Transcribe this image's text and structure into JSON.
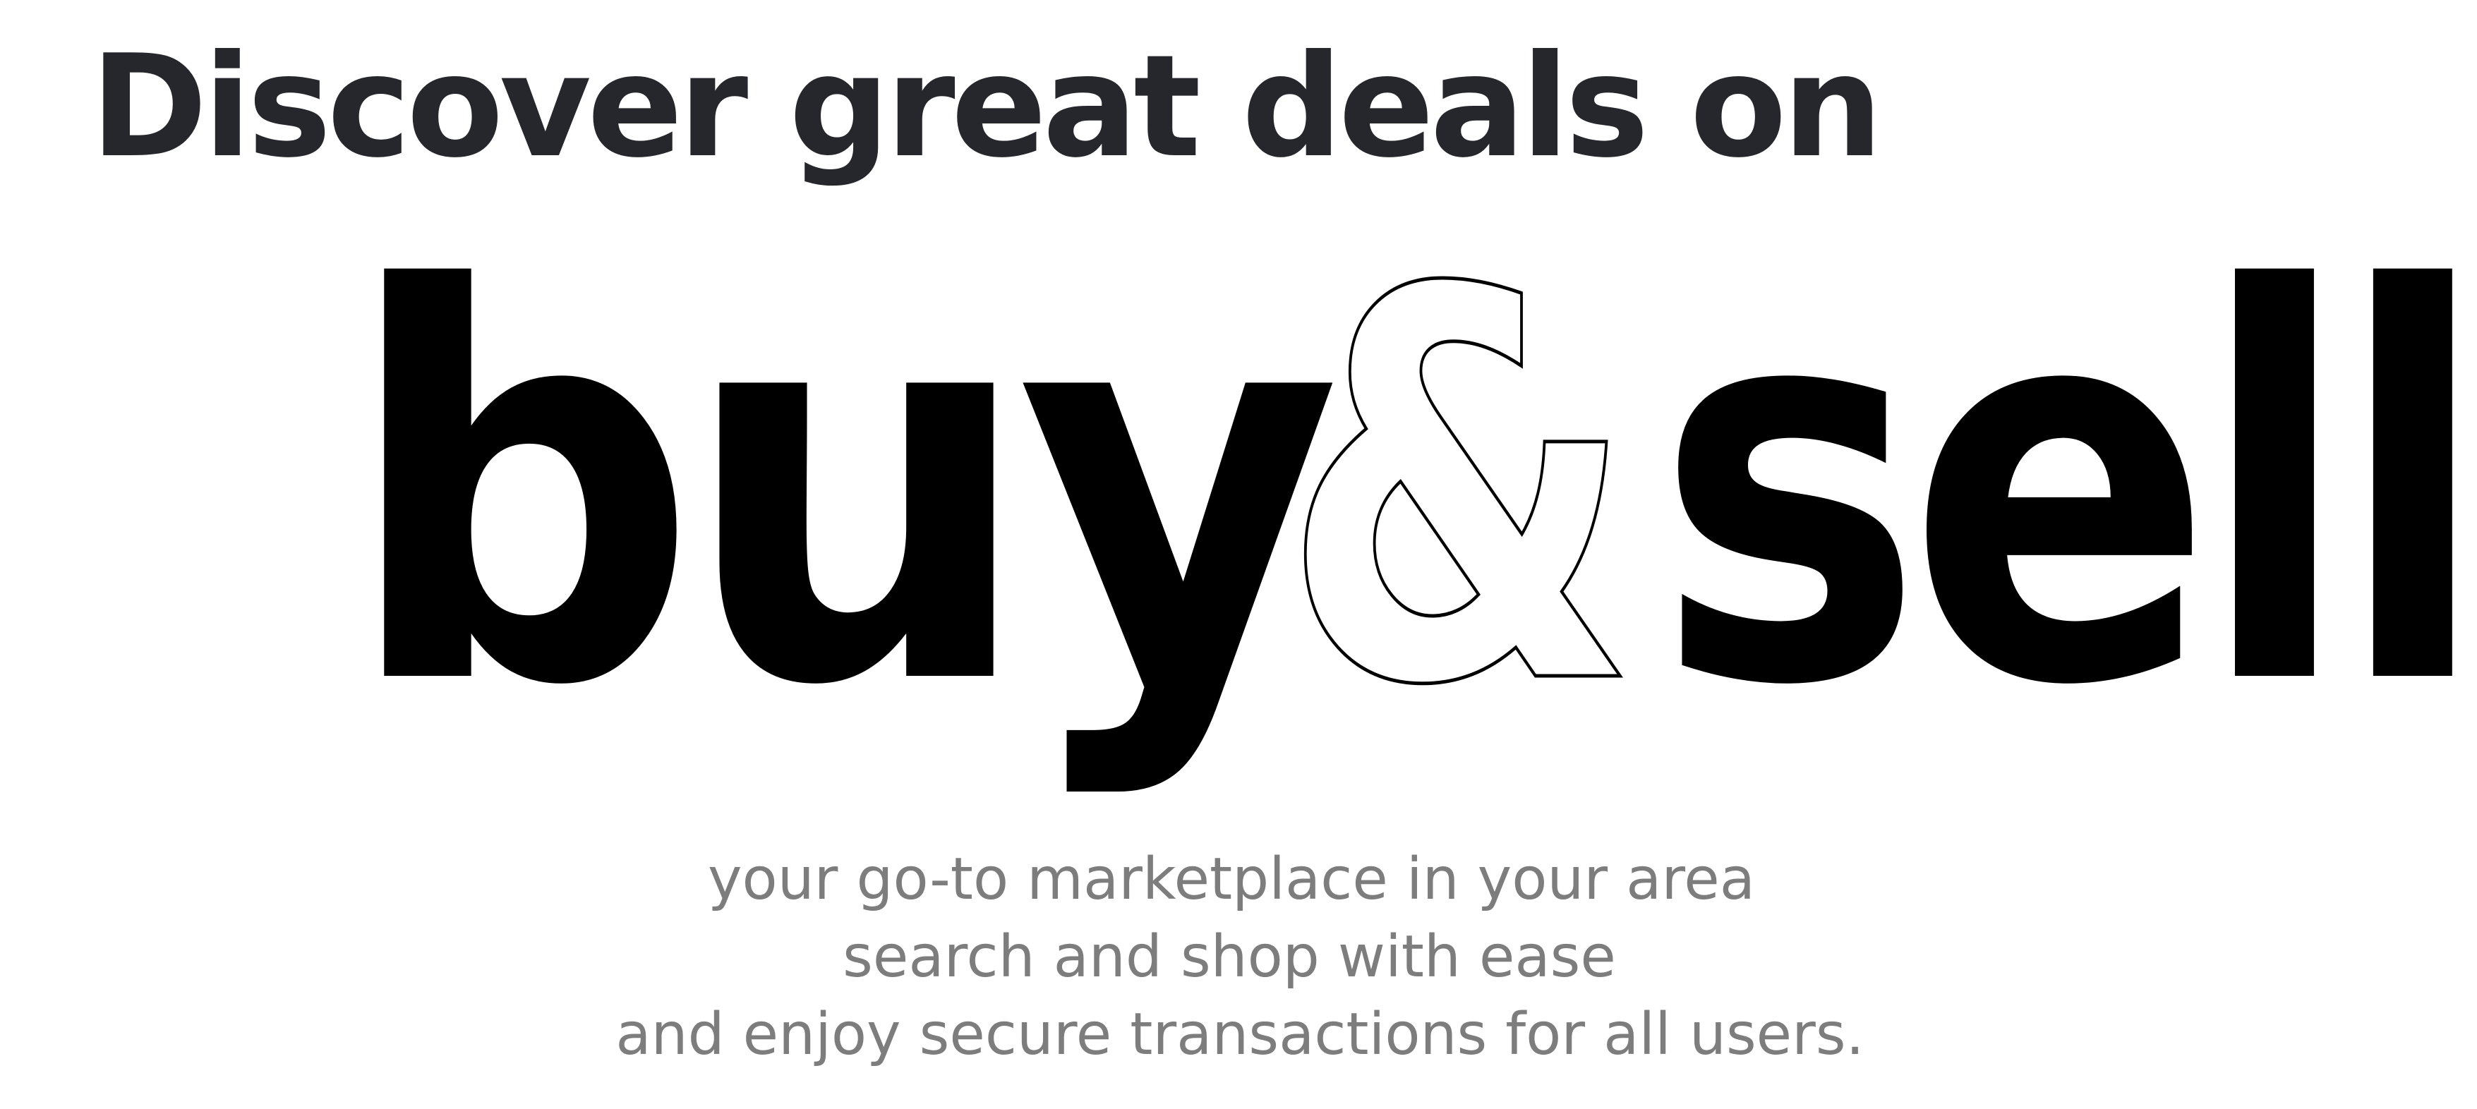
{
  "headline": "Discover great deals on",
  "hero": {
    "word_left": "buy",
    "ampersand": "&",
    "word_right": "sell"
  },
  "tagline": {
    "lines": [
      "your go-to marketplace in your area",
      "search and shop with ease",
      "and enjoy secure transactions for all users."
    ]
  },
  "colors": {
    "headline": "#25272c",
    "hero": "#000000",
    "tagline": "#7d7d7d",
    "background": "#ffffff"
  }
}
